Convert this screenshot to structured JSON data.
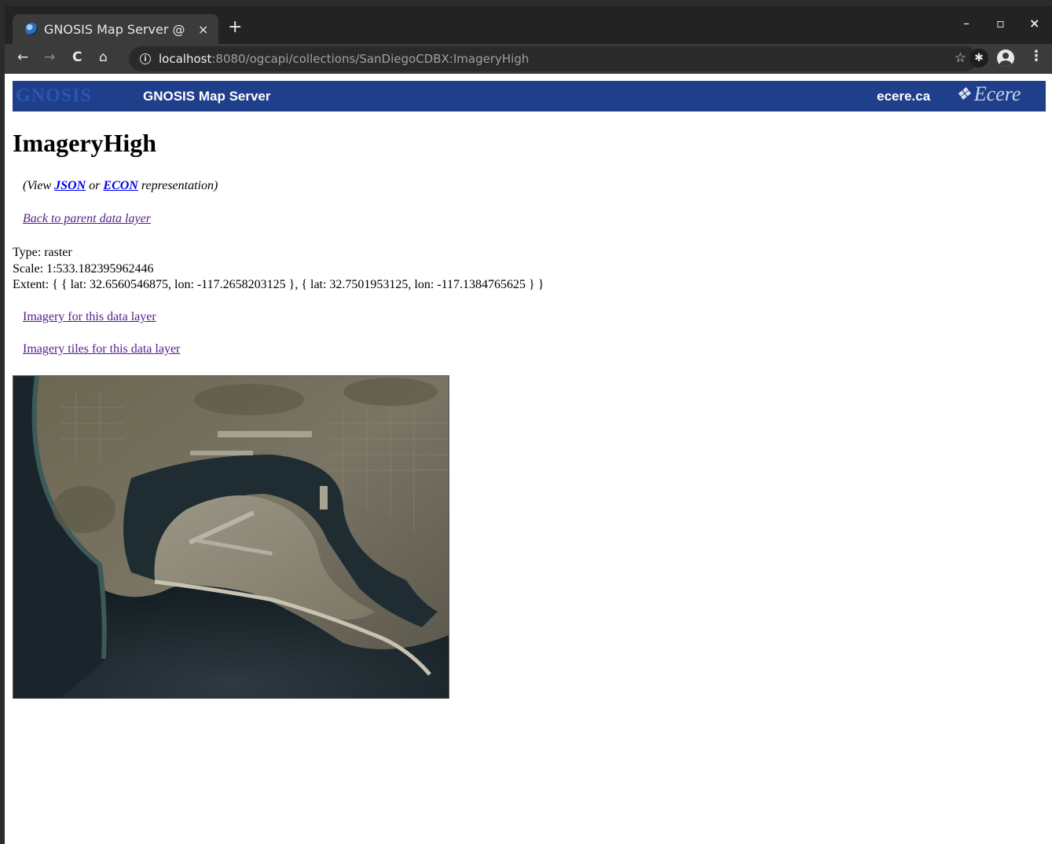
{
  "browser": {
    "tab_title": "GNOSIS Map Server @",
    "tab_close": "×",
    "new_tab": "+",
    "window_controls": {
      "minimize": "–",
      "maximize": "▫",
      "close": "×"
    },
    "nav": {
      "back": "←",
      "forward": "→",
      "reload": "C",
      "home": "⌂"
    },
    "url_host": "localhost",
    "url_path": ":8080/ogcapi/collections/SanDiegoCDBX:ImageryHigh",
    "star": "☆",
    "extensions": "✱",
    "menu": "⋮"
  },
  "banner": {
    "logo_text": "GNOSIS",
    "title": "GNOSIS Map Server",
    "link": "ecere.ca",
    "ecere_logo": "Ecere"
  },
  "page": {
    "title": "ImageryHigh",
    "repr_prefix": "(View ",
    "repr_json": "JSON",
    "repr_or": " or ",
    "repr_econ": "ECON",
    "repr_suffix": " representation)",
    "back_link": "Back to parent data layer",
    "type_line": "Type: raster",
    "scale_line": "Scale: 1:533.182395962446",
    "extent_line": "Extent: { { lat: 32.6560546875, lon: -117.2658203125 }, { lat: 32.7501953125, lon: -117.1384765625 } }",
    "imagery_link": "Imagery for this data layer",
    "tiles_link": "Imagery tiles for this data layer"
  }
}
